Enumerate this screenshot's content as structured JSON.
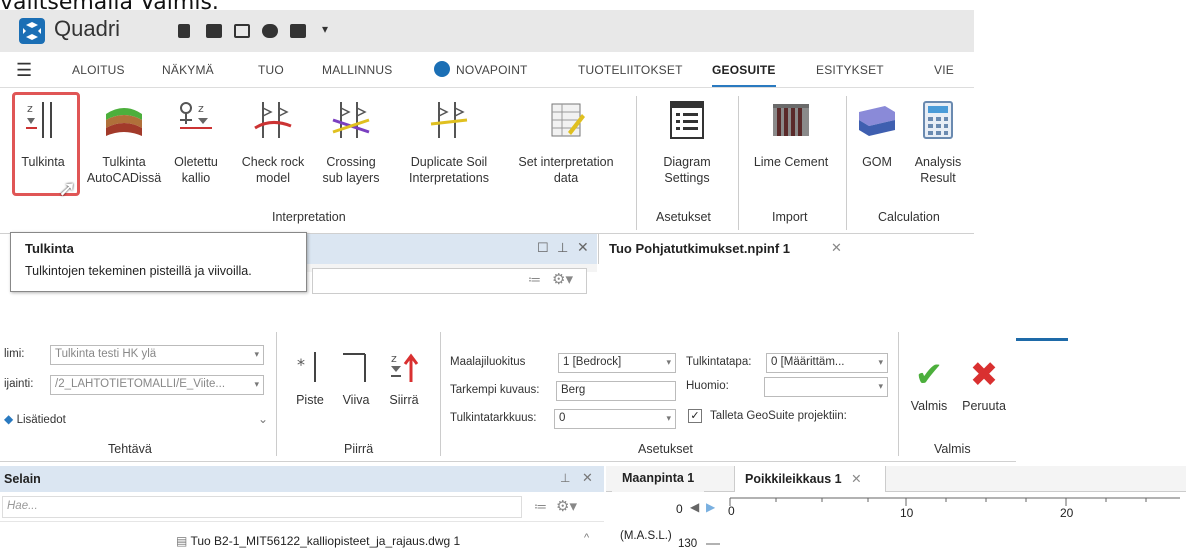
{
  "caption": "valitsemalla Valmis.",
  "app": {
    "title": "Quadri"
  },
  "menu": {
    "tabs": [
      "ALOITUS",
      "NÄKYMÄ",
      "TUO",
      "MALLINNUS",
      "NOVAPOINT",
      "TUOTELIITOKSET",
      "GEOSUITE",
      "ESITYKSET",
      "VIE"
    ],
    "active": "GEOSUITE"
  },
  "ribbon": {
    "buttons": [
      {
        "label1": "Tulkinta",
        "label2": ""
      },
      {
        "label1": "Tulkinta",
        "label2": "AutoCADissä"
      },
      {
        "label1": "Oletettu",
        "label2": "kallio"
      },
      {
        "label1": "Check rock",
        "label2": "model"
      },
      {
        "label1": "Crossing",
        "label2": "sub layers"
      },
      {
        "label1": "Duplicate Soil",
        "label2": "Interpretations"
      },
      {
        "label1": "Set interpretation",
        "label2": "data"
      },
      {
        "label1": "Diagram",
        "label2": "Settings"
      },
      {
        "label1": "Lime Cement",
        "label2": ""
      },
      {
        "label1": "GOM",
        "label2": ""
      },
      {
        "label1": "Analysis",
        "label2": "Result"
      }
    ],
    "groups": [
      "Interpretation",
      "Asetukset",
      "Import",
      "Calculation"
    ]
  },
  "tooltip": {
    "title": "Tulkinta",
    "description": "Tulkintojen tekeminen pisteillä ja viivoilla."
  },
  "doc_tab_top": "Tuo Pohjatutkimukset.npinf 1",
  "ribbon2": {
    "task": {
      "nimi_label": "limi:",
      "nimi_value": "Tulkinta testi HK ylä",
      "sijainti_label": "ijainti:",
      "sijainti_value": "/2_LAHTOTIETOMALLI/E_Viite...",
      "lisatiedot": "Lisätiedot",
      "group": "Tehtävä"
    },
    "draw": {
      "piste": "Piste",
      "viiva": "Viiva",
      "siirra": "Siirrä",
      "group": "Piirrä"
    },
    "settings": {
      "maalaji_label": "Maalajiluokitus",
      "maalaji_value": "1 [Bedrock]",
      "kuvaus_label": "Tarkempi kuvaus:",
      "kuvaus_value": "Berg",
      "tarkkuus_label": "Tulkintatarkkuus:",
      "tarkkuus_value": "0",
      "tapa_label": "Tulkintatapa:",
      "tapa_value": "0 [Määrittäm...",
      "huomio_label": "Huomio:",
      "huomio_value": "",
      "talleta_label": "Talleta GeoSuite projektiin:",
      "talleta_checked": true,
      "group": "Asetukset"
    },
    "finish": {
      "valmis": "Valmis",
      "peruuta": "Peruuta",
      "group": "Valmis"
    }
  },
  "browser": {
    "title": "Selain",
    "search_placeholder": "Hae...",
    "row_item": "Tuo B2-1_MIT56122_kalliopisteet_ja_rajaus.dwg 1"
  },
  "doc_tabs_bottom": [
    "Maanpinta 1",
    "Poikkileikkaus 1"
  ],
  "section_view": {
    "x_ticks": [
      "0",
      "10",
      "20"
    ],
    "axis_unit": "(M.A.S.L.)",
    "y_tick": "130",
    "nav_value": "0"
  },
  "colors": {
    "accent": "#2a7ac0",
    "highlight": "#e05656",
    "panel": "#dbe6f2",
    "ok": "#4caf3c",
    "cancel": "#d93030"
  }
}
